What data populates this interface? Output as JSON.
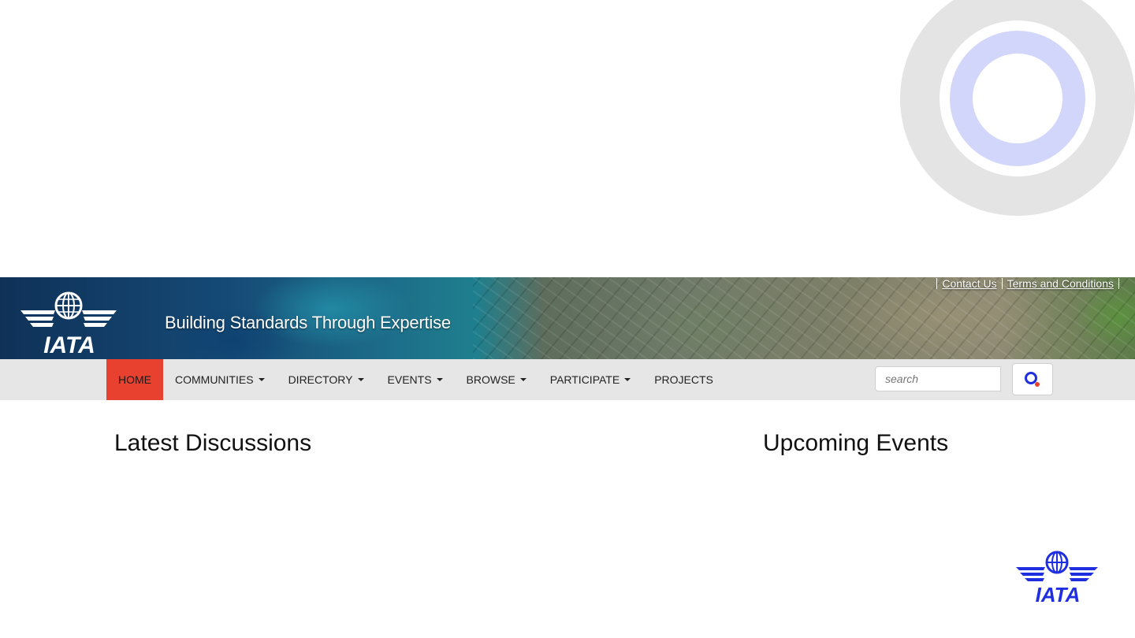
{
  "header": {
    "logo_text": "IATA",
    "tagline": "Building Standards Through Expertise",
    "links": [
      {
        "label": "Contact Us"
      },
      {
        "label": "Terms and Conditions"
      }
    ]
  },
  "nav": {
    "items": [
      {
        "label": "HOME",
        "active": true,
        "dropdown": false
      },
      {
        "label": "COMMUNITIES",
        "dropdown": true
      },
      {
        "label": "DIRECTORY",
        "dropdown": true
      },
      {
        "label": "EVENTS",
        "dropdown": true
      },
      {
        "label": "BROWSE",
        "dropdown": true
      },
      {
        "label": "PARTICIPATE",
        "dropdown": true
      },
      {
        "label": "PROJECTS",
        "dropdown": false
      }
    ]
  },
  "search": {
    "placeholder": "search",
    "button_icon": "search-icon"
  },
  "main": {
    "discussions_heading": "Latest Discussions",
    "events_heading": "Upcoming Events"
  },
  "footer": {
    "logo_text": "IATA"
  },
  "colors": {
    "active_nav": "#e8412f",
    "navbar_bg": "#e6e6e6",
    "logo_blue": "#1f2fe0",
    "ring_grey": "#e4e4e4",
    "ring_lavender": "#d3d6fb"
  }
}
